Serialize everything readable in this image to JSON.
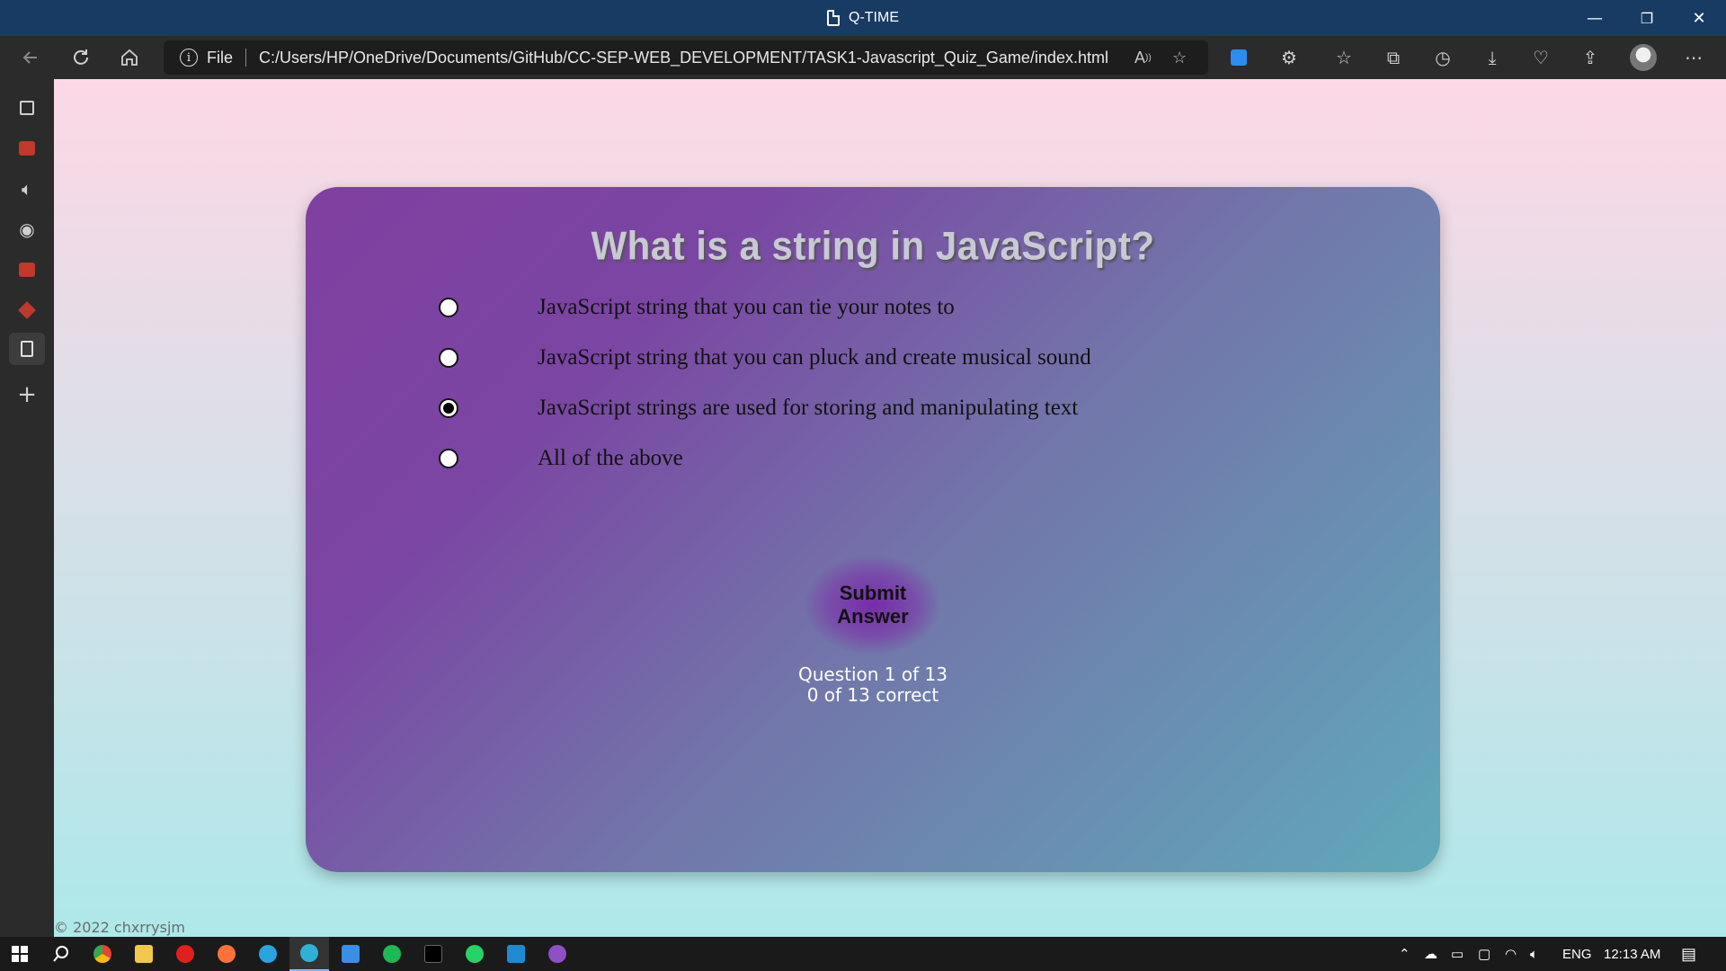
{
  "window": {
    "title": "Q-TIME",
    "controls": {
      "minimize": "—",
      "restore": "❐",
      "close": "✕"
    }
  },
  "toolbar": {
    "address_prefix": "File",
    "url": "C:/Users/HP/OneDrive/Documents/GitHub/CC-SEP-WEB_DEVELOPMENT/TASK1-Javascript_Quiz_Game/index.html",
    "icons": [
      "back-icon",
      "refresh-icon",
      "home-icon",
      "info-icon",
      "read-aloud-icon",
      "add-favorite-icon",
      "extension-icon",
      "extensions-icon",
      "favorites-icon",
      "collections-icon",
      "history-icon",
      "downloads-icon",
      "performance-icon",
      "share-icon",
      "profile-avatar",
      "more-icon"
    ]
  },
  "sidebar": {
    "icons": [
      "tab-actions-icon",
      "pdf-icon",
      "audio-icon",
      "github-icon",
      "pdf-icon",
      "git-icon",
      "file-icon",
      "add-icon"
    ]
  },
  "quiz": {
    "question": "What is a string in JavaScript?",
    "options": [
      {
        "label": "JavaScript string that you can tie your notes to",
        "selected": false
      },
      {
        "label": "JavaScript string that you can pluck and create musical sound",
        "selected": false
      },
      {
        "label": "JavaScript strings are used for storing and manipulating text",
        "selected": true
      },
      {
        "label": "All of the above",
        "selected": false
      }
    ],
    "submit_label_line1": "Submit",
    "submit_label_line2": "Answer",
    "progress_question": "Question 1 of 13",
    "progress_correct": "0 of 13 correct"
  },
  "footer": {
    "copyright": "© 2022 chxrrysjm"
  },
  "taskbar": {
    "apps": [
      "chrome",
      "file-explorer",
      "opera",
      "firefox",
      "telegram",
      "edge",
      "todo",
      "spotify",
      "terminal",
      "whatsapp",
      "vscode",
      "github-desktop"
    ],
    "tray": {
      "language": "ENG",
      "time": "12:13 AM"
    }
  },
  "colors": {
    "title_bar": "#173b63",
    "page_gradient_top": "#fdd8e6",
    "page_gradient_bottom": "#aee8ea",
    "card_start": "#8040a0",
    "card_end": "#60a9ba"
  }
}
